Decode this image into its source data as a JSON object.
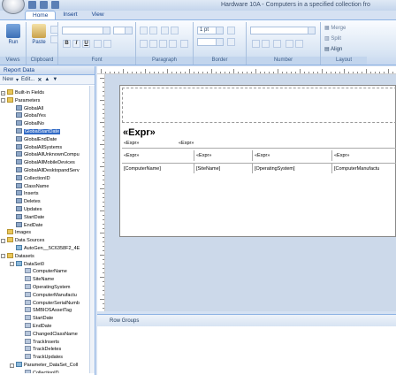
{
  "window": {
    "title": "Hardware 10A - Computers in a specified collection fro"
  },
  "tabs": [
    "Home",
    "Insert",
    "View"
  ],
  "ribbon": {
    "views": {
      "run_label": "Run",
      "group": "Views"
    },
    "clipboard": {
      "paste_label": "Paste",
      "group": "Clipboard"
    },
    "font": {
      "group": "Font",
      "bold": "B",
      "italic": "I",
      "underline": "U"
    },
    "paragraph": {
      "group": "Paragraph"
    },
    "border": {
      "group": "Border",
      "width_value": "1 pt"
    },
    "number": {
      "group": "Number"
    },
    "layout": {
      "group": "Layout",
      "merge": "Merge",
      "split": "Split",
      "align": "Align"
    }
  },
  "panel": {
    "title": "Report Data",
    "new_label": "New",
    "edit_label": "Edit..."
  },
  "tree": {
    "builtin": "Built-in Fields",
    "parameters": "Parameters",
    "params": [
      "GlobalAll",
      "GlobalYes",
      "GlobalNo",
      "GlobalStartDate",
      "GlobalEndDate",
      "GlobalAllSystems",
      "GlobalAllUnknownCompu",
      "GlobalAllMobileDevices",
      "GlobalAllDesktopandServ",
      "CollectionID",
      "ClassName",
      "Inserts",
      "Deletes",
      "Updates",
      "StartDate",
      "EndDate"
    ],
    "images": "Images",
    "datasources": "Data Sources",
    "datasource_item": "AutoGen__5C6358F2_4E",
    "datasets": "Datasets",
    "dataset0": "DataSet0",
    "fields": [
      "ComputerName",
      "SiteName",
      "OperatingSystem",
      "ComputerManufactu",
      "ComputerSerialNumb",
      "SMBIOSAssetTag",
      "StartDate",
      "EndDate",
      "ChangedClassName",
      "TrackInserts",
      "TrackDeletes",
      "TrackUpdates"
    ],
    "param_dataset": "Parameter_DataSet_Coll",
    "param_dataset_field": "CollectionID"
  },
  "report": {
    "big_expr": "«Expr»",
    "small_expr_1": "«Expr»",
    "small_expr_2": "«Expr»",
    "table_headers": [
      "«Expr»",
      "«Expr»",
      "«Expr»",
      "«Expr»"
    ],
    "table_cells": [
      "[ComputerName]",
      "[SiteName]",
      "[OperatingSystem]",
      "[ComputerManufactu"
    ]
  },
  "row_groups": "Row Groups"
}
